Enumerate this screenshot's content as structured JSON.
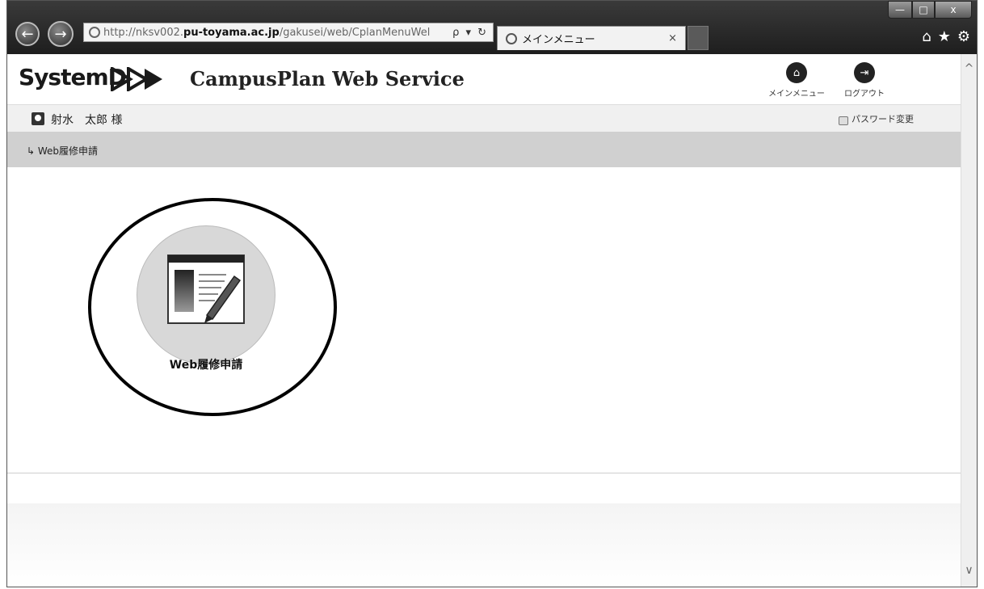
{
  "browser": {
    "url_prefix": "http://nksv002.",
    "url_host": "pu-toyama.ac.jp",
    "url_path": "/gakusei/web/CplanMenuWel",
    "address_tools": "ρ ▾ ↻",
    "tab_title": "メインメニュー",
    "tab_close": "×",
    "back_glyph": "←",
    "forward_glyph": "→",
    "toolbar_icons": [
      "home-icon",
      "favorites-star-icon",
      "settings-gear-icon"
    ],
    "toolbar_glyphs": [
      "⌂",
      "★",
      "⚙"
    ],
    "window_buttons": {
      "minimize": "—",
      "maximize": "□",
      "close": "x"
    }
  },
  "header": {
    "logo_text": "SystemD",
    "app_name": "CampusPlan Web Service",
    "main_menu_label": "メインメニュー",
    "logout_label": "ログアウト"
  },
  "userbar": {
    "user_name": "射水　太郎 様",
    "password_change_label": "パスワード変更"
  },
  "breadcrumb": {
    "item": "↳ Web履修申請"
  },
  "menu": {
    "tiles": [
      {
        "label": "Web履修申請",
        "icon": "document-edit-icon"
      }
    ]
  },
  "scrollbar": {
    "up": "^",
    "down": "∨"
  },
  "colors": {
    "titlebar": "#2a2a2a",
    "userbar": "#f0f0f0",
    "breadbar": "#d0d0d0",
    "tile_bg": "#d8d8d8"
  }
}
